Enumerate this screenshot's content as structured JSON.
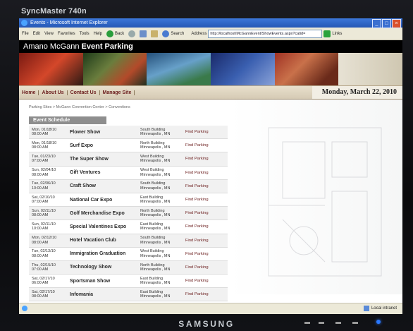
{
  "monitor": {
    "model": "SyncMaster 740n",
    "brand": "SAMSUNG"
  },
  "window": {
    "title": "Events - Microsoft Internet Explorer"
  },
  "browser": {
    "menu": [
      "File",
      "Edit",
      "View",
      "Favorites",
      "Tools",
      "Help"
    ],
    "back_label": "Back",
    "search_label": "Search",
    "address_label": "Address",
    "url": "http://localhost/McGannEvent/ShowEvents.aspx?catid=",
    "links_label": "Links"
  },
  "site": {
    "title_plain": "Amano McGann",
    "title_bold": "Event Parking",
    "nav": [
      "Home",
      "About Us",
      "Contact Us",
      "Manage Site"
    ],
    "date": "Monday, March 22, 2010",
    "breadcrumb": "Parking Sites > McGann Convention Center > Conventions",
    "schedule_title": "Event Schedule",
    "find_label": "Find Parking"
  },
  "events": [
    {
      "date": "Mon, 01/18/10",
      "time": "08:00 AM",
      "name": "Flower Show",
      "building": "South Building",
      "city": "Minneapolis , MN"
    },
    {
      "date": "Mon, 01/18/10",
      "time": "08:00 AM",
      "name": "Surf Expo",
      "building": "North Building",
      "city": "Minneapolis , MN"
    },
    {
      "date": "Tue, 01/23/10",
      "time": "07:00 AM",
      "name": "The Super Show",
      "building": "West Building",
      "city": "Minneapolis , MN"
    },
    {
      "date": "Sun, 02/04/10",
      "time": "08:00 AM",
      "name": "Gift Ventures",
      "building": "West Building",
      "city": "Minneapolis , MN"
    },
    {
      "date": "Tue, 02/06/10",
      "time": "10:00 AM",
      "name": "Craft Show",
      "building": "South Building",
      "city": "Minneapolis , MN"
    },
    {
      "date": "Sat, 02/10/10",
      "time": "07:00 AM",
      "name": "National Car Expo",
      "building": "East Building",
      "city": "Minneapolis , MN"
    },
    {
      "date": "Sun, 02/11/10",
      "time": "08:00 AM",
      "name": "Golf Merchandise Expo",
      "building": "North Building",
      "city": "Minneapolis , MN"
    },
    {
      "date": "Sun, 02/11/10",
      "time": "10:00 AM",
      "name": "Special Valentines Expo",
      "building": "East Building",
      "city": "Minneapolis , MN"
    },
    {
      "date": "Mon, 02/12/10",
      "time": "08:00 AM",
      "name": "Hotel Vacation Club",
      "building": "South Building",
      "city": "Minneapolis , MN"
    },
    {
      "date": "Tue, 02/13/10",
      "time": "08:00 AM",
      "name": "Immigration Graduation",
      "building": "West Building",
      "city": "Minneapolis , MN"
    },
    {
      "date": "Thu, 02/15/10",
      "time": "07:00 AM",
      "name": "Technology Show",
      "building": "North Building",
      "city": "Minneapolis , MN"
    },
    {
      "date": "Sat, 02/17/10",
      "time": "06:00 AM",
      "name": "Sportsman Show",
      "building": "East Building",
      "city": "Minneapolis , MN"
    },
    {
      "date": "Sat, 02/17/10",
      "time": "08:00 AM",
      "name": "Infomania",
      "building": "East Building",
      "city": "Minneapolis , MN"
    }
  ],
  "status": {
    "zone": "Local intranet"
  }
}
